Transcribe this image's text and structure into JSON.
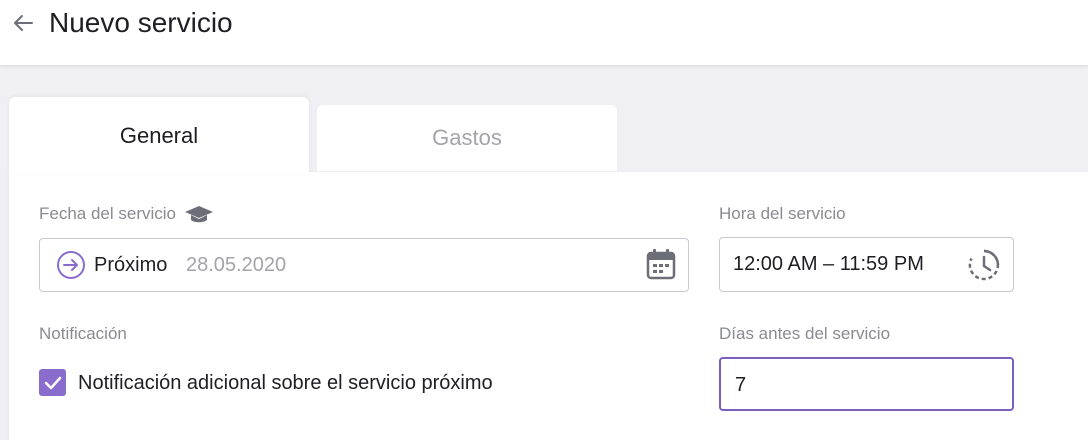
{
  "header": {
    "title": "Nuevo servicio",
    "back_icon": "arrow-left-icon"
  },
  "tabs": [
    {
      "label": "General",
      "active": true
    },
    {
      "label": "Gastos",
      "active": false
    }
  ],
  "form": {
    "date_label": "Fecha del servicio",
    "date_label_icon": "graduation-cap-icon",
    "date_mode": "Próximo",
    "date_value": "28.05.2020",
    "time_label": "Hora del servicio",
    "time_value": "12:00 AM – 11:59 PM",
    "notification_label": "Notificación",
    "notification_checkbox_label": "Notificación adicional sobre el servicio próximo",
    "notification_checked": true,
    "days_label": "Días antes del servicio",
    "days_value": "7"
  },
  "colors": {
    "accent": "#8a6ccc",
    "accent_border": "#7a5fc0",
    "label_gray": "#8a8a92",
    "icon_gray": "#6e6e78",
    "background": "#efeff4"
  }
}
